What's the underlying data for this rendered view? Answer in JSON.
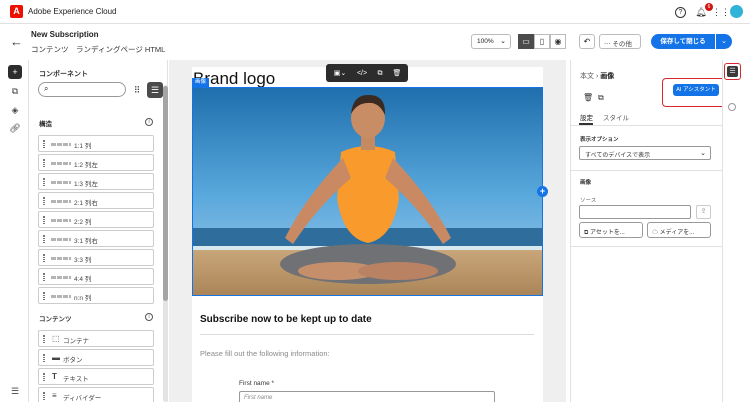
{
  "topbar": {
    "logo_glyph": "A",
    "app_title": "Adobe Experience Cloud",
    "notification_count": "6",
    "icons": [
      "help-icon",
      "bell-icon",
      "apps-grid-icon",
      "avatar"
    ]
  },
  "header": {
    "title": "New Subscription",
    "breadcrumb": "コンテンツ　ランディングページ HTML",
    "zoom": "100%",
    "more_label": "その他",
    "save_label": "保存して閉じる"
  },
  "components_panel": {
    "title": "コンポーネント",
    "search_placeholder": "",
    "structure_title": "構造",
    "structure_items": [
      "1:1 列",
      "1:2 列左",
      "1:3 列左",
      "2:1 列右",
      "2:2 列",
      "3:1 列右",
      "3:3 列",
      "4:4 列",
      "n:n 列"
    ],
    "content_title": "コンテンツ",
    "content_items": [
      {
        "icon": "container-icon",
        "glyph": "⬚",
        "label": "コンテナ"
      },
      {
        "icon": "button-icon",
        "glyph": "▬",
        "label": "ボタン"
      },
      {
        "icon": "text-icon",
        "glyph": "T",
        "label": "テキスト"
      },
      {
        "icon": "divider-icon",
        "glyph": "≡",
        "label": "ディバイダー"
      }
    ]
  },
  "canvas": {
    "brand_logo": "Brand logo",
    "image_tag": "画像",
    "subscribe_title": "Subscribe now to be kept up to date",
    "fill_text": "Please fill out the following information:",
    "first_name_label": "First name *",
    "first_name_placeholder": "First name"
  },
  "right_panel": {
    "breadcrumb_parent": "本文",
    "breadcrumb_current": "画像",
    "tab_settings": "設定",
    "tab_style": "スタイル",
    "display_options_label": "表示オプション",
    "display_select_value": "すべてのデバイスで表示",
    "image_label": "画像",
    "source_label": "ソース",
    "asset_button": "アセットを...",
    "media_button": "メディアを...",
    "ai_assistant": "AI アシスタント"
  },
  "colors": {
    "accent": "#1473e6",
    "adobe_red": "#eb1000",
    "highlight": "#d9262f"
  }
}
